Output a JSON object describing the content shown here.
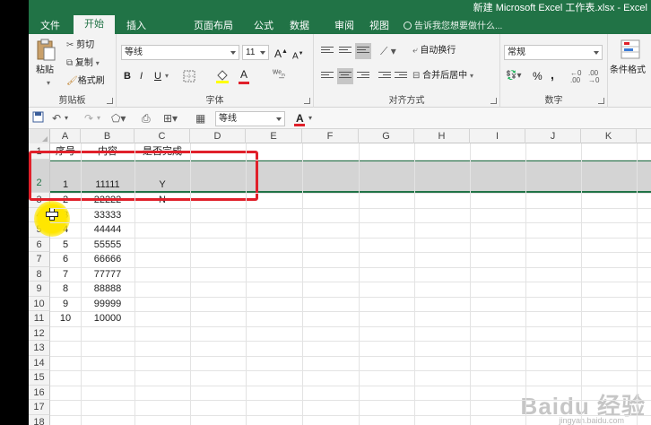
{
  "window": {
    "title": "新建 Microsoft Excel 工作表.xlsx - Excel"
  },
  "tabs": [
    "文件",
    "开始",
    "插入",
    "页面布局",
    "公式",
    "数据",
    "审阅",
    "视图"
  ],
  "tellme": "告诉我您想要做什么...",
  "ribbon": {
    "clipboard": {
      "paste": "粘贴",
      "cut": "剪切",
      "copy": "复制",
      "format_painter": "格式刷",
      "label": "剪贴板"
    },
    "font": {
      "name": "等线",
      "size": "11",
      "bold": "B",
      "italic": "I",
      "underline": "U",
      "label": "字体"
    },
    "alignment": {
      "wrap": "自动换行",
      "merge": "合并后居中",
      "label": "对齐方式"
    },
    "number": {
      "format": "常规",
      "percent": "%",
      "comma": ",",
      "label": "数字"
    },
    "styles": {
      "conditional": "条件格式"
    }
  },
  "qat": {
    "font": "等线"
  },
  "columns": [
    "A",
    "B",
    "C",
    "D",
    "E",
    "F",
    "G",
    "H",
    "I",
    "J",
    "K"
  ],
  "row_numbers": [
    "1",
    "2",
    "3",
    "4",
    "5",
    "6",
    "7",
    "8",
    "9",
    "10",
    "11",
    "12",
    "13",
    "14",
    "15",
    "16",
    "17",
    "18"
  ],
  "headers": {
    "a": "序号",
    "b": "内容",
    "c": "是否完成"
  },
  "rows": [
    {
      "a": "1",
      "b": "11111",
      "c": "Y"
    },
    {
      "a": "2",
      "b": "22222",
      "c": "N"
    },
    {
      "a": "3",
      "b": "33333",
      "c": ""
    },
    {
      "a": "4",
      "b": "44444",
      "c": ""
    },
    {
      "a": "5",
      "b": "55555",
      "c": ""
    },
    {
      "a": "6",
      "b": "66666",
      "c": ""
    },
    {
      "a": "7",
      "b": "77777",
      "c": ""
    },
    {
      "a": "8",
      "b": "88888",
      "c": ""
    },
    {
      "a": "9",
      "b": "99999",
      "c": ""
    },
    {
      "a": "10",
      "b": "10000",
      "c": ""
    }
  ],
  "watermark": {
    "main": "Baidu 经验",
    "sub": "jingyan.baidu.com"
  }
}
